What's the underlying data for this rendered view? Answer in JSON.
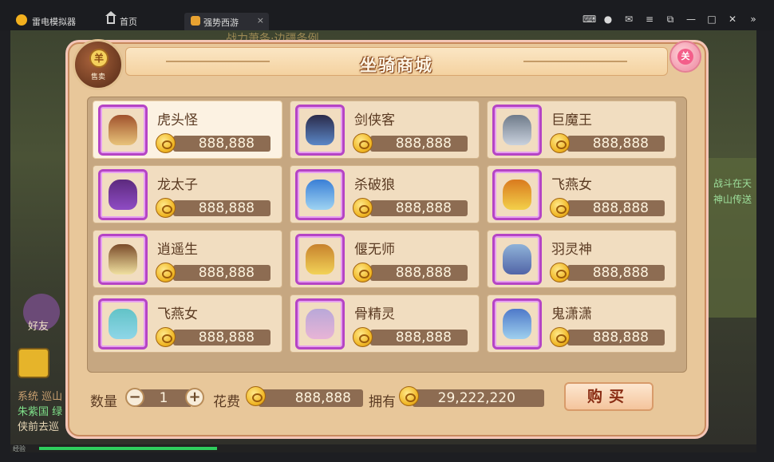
{
  "emulator": {
    "app_name": "雷电模拟器",
    "tabs": [
      {
        "label": "首页"
      },
      {
        "label": "强势西游"
      }
    ],
    "tab_close": "×",
    "window_controls": [
      "gamepad",
      "user",
      "mail",
      "menu",
      "popout",
      "minimize",
      "maximize",
      "close",
      "collapse"
    ]
  },
  "scene": {
    "top_banner": "战力萧条·边疆条例",
    "right_text_1": "战斗在天",
    "right_text_2": "神山传送",
    "friends_label": "好友",
    "chat": [
      {
        "text": "系统 巡山"
      },
      {
        "text": "朱紫国 绿"
      },
      {
        "text": "侠前去巡"
      }
    ],
    "xp_label": "经验",
    "xp_fraction": 0.24
  },
  "shop": {
    "title": "坐骑商城",
    "sell_badge_label": "售卖",
    "sell_badge_symbol": "羊",
    "close_label": "关",
    "items": [
      {
        "name": "虎头怪",
        "price": "888,888",
        "selected": true
      },
      {
        "name": "剑侠客",
        "price": "888,888"
      },
      {
        "name": "巨魔王",
        "price": "888,888"
      },
      {
        "name": "龙太子",
        "price": "888,888"
      },
      {
        "name": "杀破狼",
        "price": "888,888"
      },
      {
        "name": "飞燕女",
        "price": "888,888"
      },
      {
        "name": "逍遥生",
        "price": "888,888"
      },
      {
        "name": "偃无师",
        "price": "888,888"
      },
      {
        "name": "羽灵神",
        "price": "888,888"
      },
      {
        "name": "飞燕女",
        "price": "888,888"
      },
      {
        "name": "骨精灵",
        "price": "888,888"
      },
      {
        "name": "鬼潇潇",
        "price": "888,888"
      }
    ],
    "quantity_label": "数量",
    "quantity_value": "1",
    "minus_label": "−",
    "plus_label": "+",
    "cost_label": "花费",
    "cost_value": "888,888",
    "own_label": "拥有",
    "own_value": "29,222,220",
    "buy_label": "购买"
  }
}
